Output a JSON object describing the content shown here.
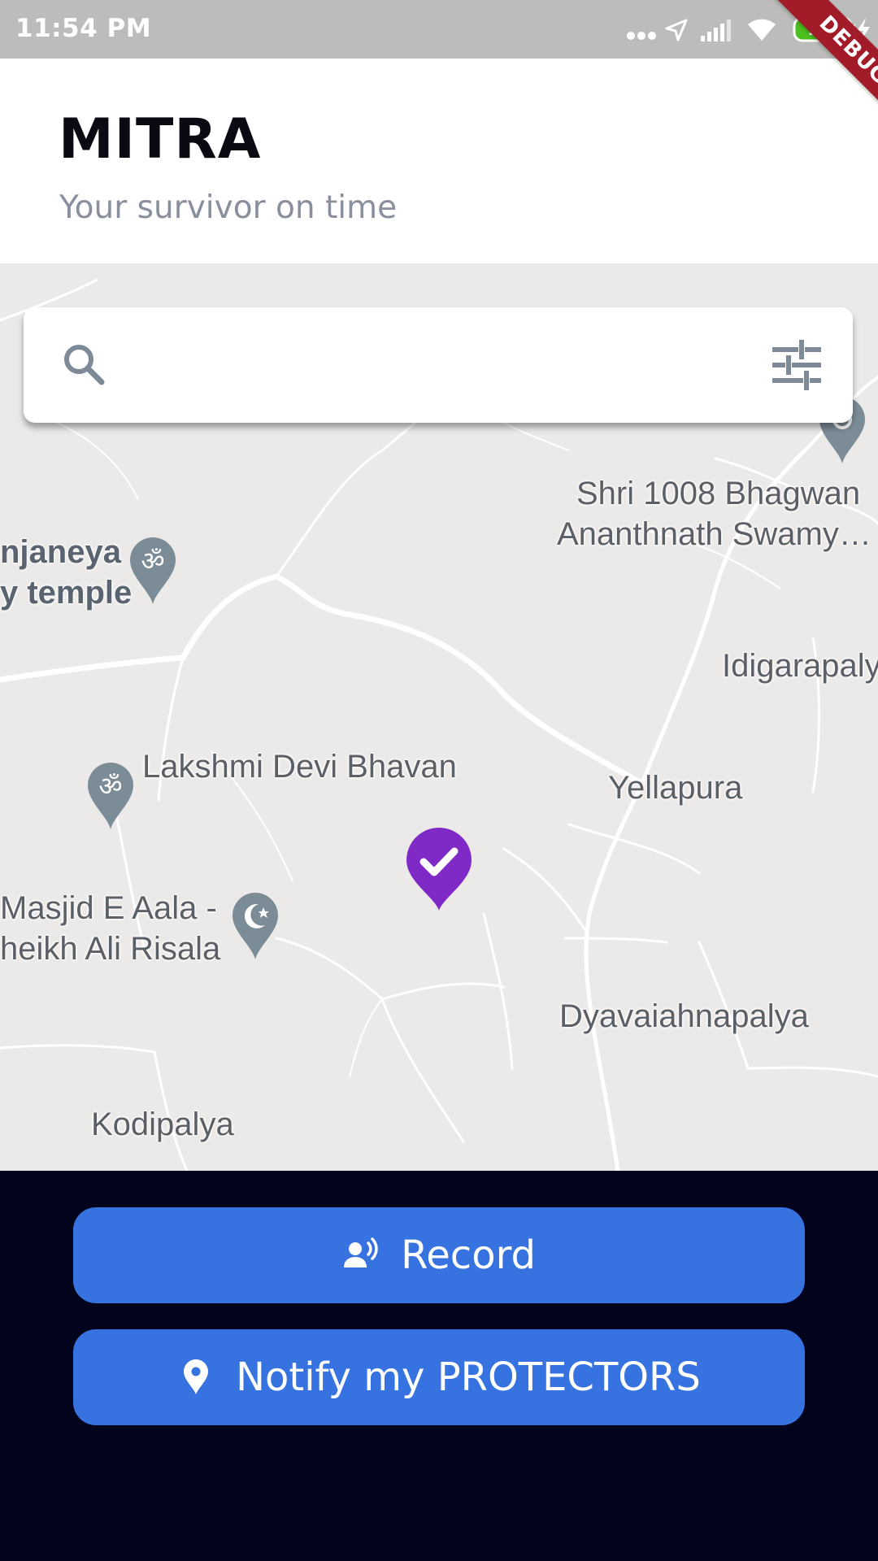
{
  "status_bar": {
    "time": "11:54 PM",
    "battery": "100",
    "icons": [
      "more-dots-icon",
      "location-arrow-icon",
      "signal-icon",
      "wifi-icon",
      "battery-icon",
      "charging-icon"
    ]
  },
  "debug_banner": "DEBUG",
  "header": {
    "title": "MITRA",
    "subtitle": "Your survivor on time"
  },
  "search": {
    "value": "",
    "placeholder": "",
    "icons": [
      "search-icon",
      "filter-sliders-icon"
    ]
  },
  "map": {
    "labels": {
      "temple_top_right_line1": "Shri 1008 Bhagwan",
      "temple_top_right_line2": "Ananthnath Swamy…",
      "anjaneya_line1": "njaneya",
      "anjaneya_line2": "y temple",
      "idigarapalya": "Idigarapalya",
      "lakshmi": "Lakshmi Devi Bhavan",
      "yellapura": "Yellapura",
      "masjid_line1": "Masjid E Aala -",
      "masjid_line2": "heikh Ali Risala",
      "dyavaiahnapalya": "Dyavaiahnapalya",
      "kodipalya": "Kodipalya"
    },
    "pin_icons": [
      "om-pin-icon",
      "crescent-pin-icon",
      "place-pin-icon",
      "check-location-marker-icon"
    ],
    "colors": {
      "background": "#ebeae8",
      "road": "#ffffff",
      "pin_grey": "#7b8c97",
      "marker_purple": "#7f2ac6"
    }
  },
  "actions": {
    "record_label": "Record",
    "notify_label": "Notify my PROTECTORS",
    "button_color": "#3673e0",
    "panel_color": "#02041d"
  }
}
